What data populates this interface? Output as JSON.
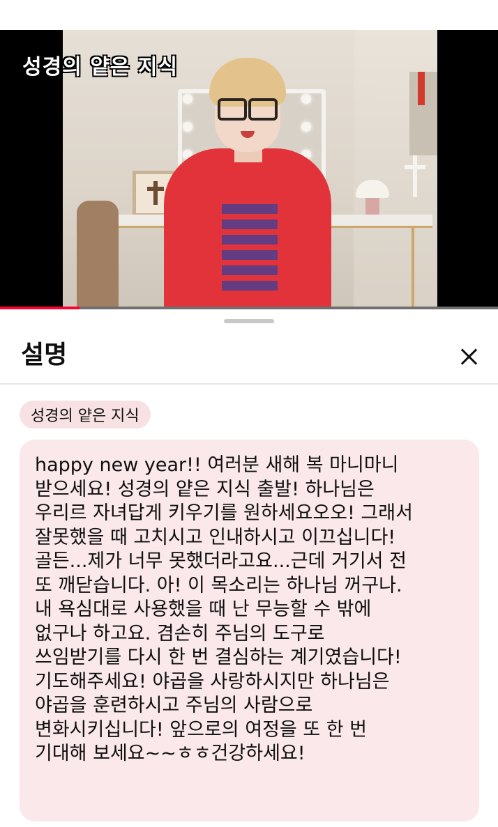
{
  "video": {
    "overlay_title": "성경의 얕은 지식",
    "progress_fraction": 0.16
  },
  "sheet": {
    "title": "설명",
    "close_label": "✕",
    "channel_chip": "성경의 얕은 지식",
    "description_lines": [
      "happy new year!! 여러분 새해 복 마니마니",
      "받으세요! 성경의 얕은 지식 출발! 하나님은",
      "우리르 자녀답게 키우기를 원하세요오오! 그래서",
      "잘못했을 때 고치시고 인내하시고 이끄십니다!",
      "골든...제가 너무 못했더라고요...근데 거기서 전",
      "또 깨닫습니다. 아! 이 목소리는 하나님 꺼구나.",
      "내 욕심대로 사용했을 때 난 무능할 수 밖에",
      "없구나 하고요. 겸손히 주님의 도구로",
      "쓰임받기를 다시 한 번 결심하는 계기였습니다!",
      "기도해주세요! 야곱을 사랑하시지만 하나님은",
      "야곱을 훈련하시고 주님의 사람으로",
      "변화시키십니다! 앞으로의 여정을 또 한 번",
      "기대해 보세요~~ㅎㅎ건강하세요!"
    ]
  },
  "colors": {
    "progress_red": "#ff0033",
    "chip_bg": "#f7e1e3",
    "description_bg": "#fae8ea",
    "shirt_red": "#e3333a"
  }
}
